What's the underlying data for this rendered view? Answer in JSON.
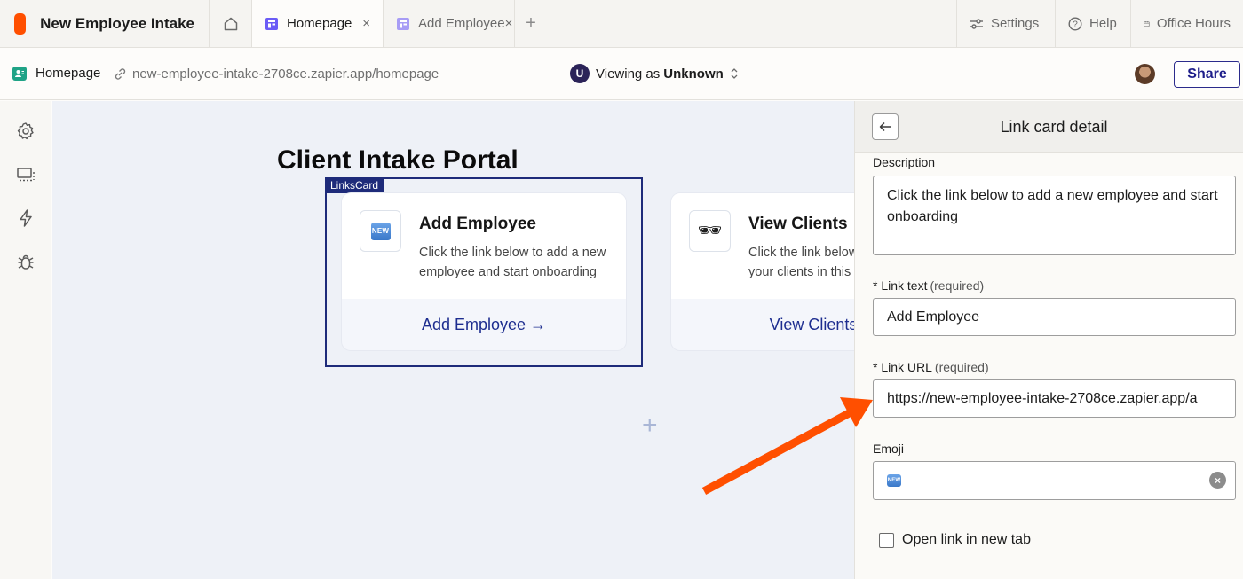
{
  "app": {
    "title": "New Employee Intake",
    "brand_color": "#ff4f00"
  },
  "tabs": [
    {
      "label": "Homepage",
      "close": "×",
      "active": true
    },
    {
      "label": "Add Employee",
      "close": "×",
      "active": false
    }
  ],
  "tab_add": "+",
  "top_right": {
    "settings": "Settings",
    "help": "Help",
    "office_hours": "Office Hours"
  },
  "subbar": {
    "page_name": "Homepage",
    "url": "new-employee-intake-2708ce.zapier.app/homepage",
    "avatar_letter": "U",
    "viewing_prefix": "Viewing as",
    "viewing_role": "Unknown",
    "share_label": "Share"
  },
  "left_rail": [
    "gear-icon",
    "display-icon",
    "lightning-icon",
    "bug-icon"
  ],
  "canvas": {
    "page_title": "Client Intake Portal",
    "selection_tag": "LinksCard",
    "add_block": "+",
    "cards": [
      {
        "title": "Add Employee",
        "description": "Click the link below to add a new employee and start onboarding",
        "link": "Add Employee →",
        "emoji": "NEW"
      },
      {
        "title": "View Clients",
        "description": "Click the link below to view all of your clients in this",
        "link": "View Clients",
        "emoji": "🕶"
      }
    ]
  },
  "panel": {
    "title": "Link card detail",
    "description_label": "Description",
    "description_value": "Click the link below to add a new employee and start onboarding",
    "link_text_label": "* Link text",
    "link_text_req": "(required)",
    "link_text_value": "Add Employee",
    "link_url_label": "* Link URL",
    "link_url_req": "(required)",
    "link_url_value": "https://new-employee-intake-2708ce.zapier.app/a",
    "emoji_label": "Emoji",
    "emoji_value": "NEW",
    "clear": "×",
    "checkbox_label": "Open link in new tab"
  },
  "colors": {
    "accent_navy": "#1e2b7a",
    "arrow": "#ff4f00",
    "canvas_bg": "#eef1f7"
  }
}
